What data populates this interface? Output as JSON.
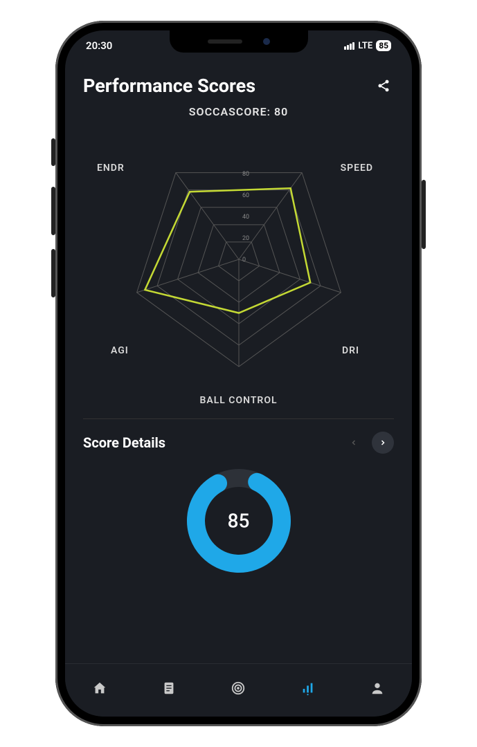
{
  "status": {
    "time": "20:30",
    "network": "LTE",
    "battery": "85"
  },
  "header": {
    "title": "Performance Scores",
    "subtitle": "SOCCASCORE: 80"
  },
  "chart_data": {
    "type": "radar",
    "title": "SOCCASCORE: 80",
    "categories": [
      "SPEED",
      "DRI",
      "BALL CONTROL",
      "AGI",
      "ENDR"
    ],
    "values": [
      82,
      70,
      50,
      92,
      78
    ],
    "ticks": [
      0,
      20,
      40,
      60,
      80
    ],
    "max": 100,
    "series_color": "#c4d934"
  },
  "labels": {
    "speed": "SPEED",
    "dri": "DRI",
    "ball": "BALL CONTROL",
    "agi": "AGI",
    "endr": "ENDR"
  },
  "details": {
    "title": "Score Details",
    "value": "85",
    "percent": 85,
    "ring_color": "#1fa8e8"
  },
  "tabs": {
    "home": "home",
    "notes": "notes",
    "target": "target",
    "stats": "stats",
    "profile": "profile",
    "active": "stats"
  }
}
